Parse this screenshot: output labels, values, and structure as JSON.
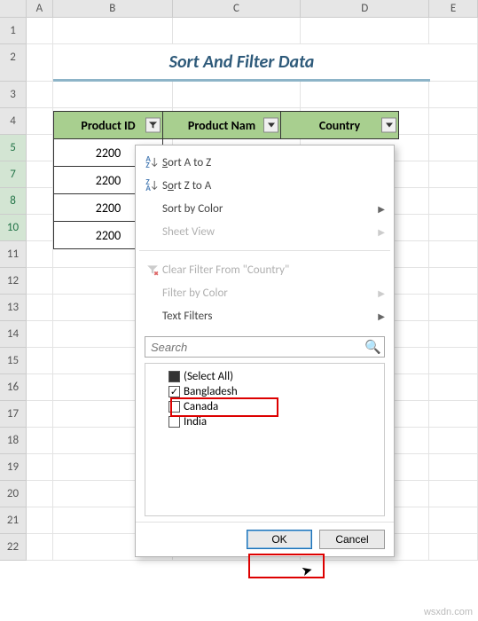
{
  "columns": [
    "A",
    "B",
    "C",
    "D",
    "E"
  ],
  "rows": [
    "1",
    "2",
    "3",
    "4",
    "5",
    "7",
    "8",
    "10",
    "11",
    "12",
    "13",
    "14",
    "15",
    "16",
    "17",
    "18",
    "19",
    "20",
    "21",
    "22"
  ],
  "title": "Sort And Filter Data",
  "headers": {
    "c1": "Product ID",
    "c2": "Product Nam",
    "c3": "Country"
  },
  "data_rows": [
    "2200",
    "2200",
    "2200",
    "2200"
  ],
  "menu": {
    "sort_az": "Sort A to Z",
    "sort_za": "Sort Z to A",
    "sort_color": "Sort by Color",
    "sheet_view": "Sheet View",
    "clear_filter": "Clear Filter From \"Country\"",
    "filter_color": "Filter by Color",
    "text_filters": "Text Filters"
  },
  "search": {
    "placeholder": "Search"
  },
  "checklist": {
    "select_all": "(Select All)",
    "items": [
      "Bangladesh",
      "Canada",
      "India"
    ]
  },
  "buttons": {
    "ok": "OK",
    "cancel": "Cancel"
  },
  "watermark": "wsxdn.com",
  "chart_data": {
    "type": "table",
    "title": "Sort And Filter Data",
    "columns": [
      "Product ID",
      "Product Name",
      "Country"
    ],
    "rows": [
      [
        "2200",
        null,
        null
      ],
      [
        "2200",
        null,
        null
      ],
      [
        "2200",
        null,
        null
      ],
      [
        "2200",
        null,
        null
      ]
    ],
    "filter_column": "Country",
    "filter_options": [
      "Bangladesh",
      "Canada",
      "India"
    ],
    "filter_selected": [
      "Bangladesh"
    ]
  }
}
